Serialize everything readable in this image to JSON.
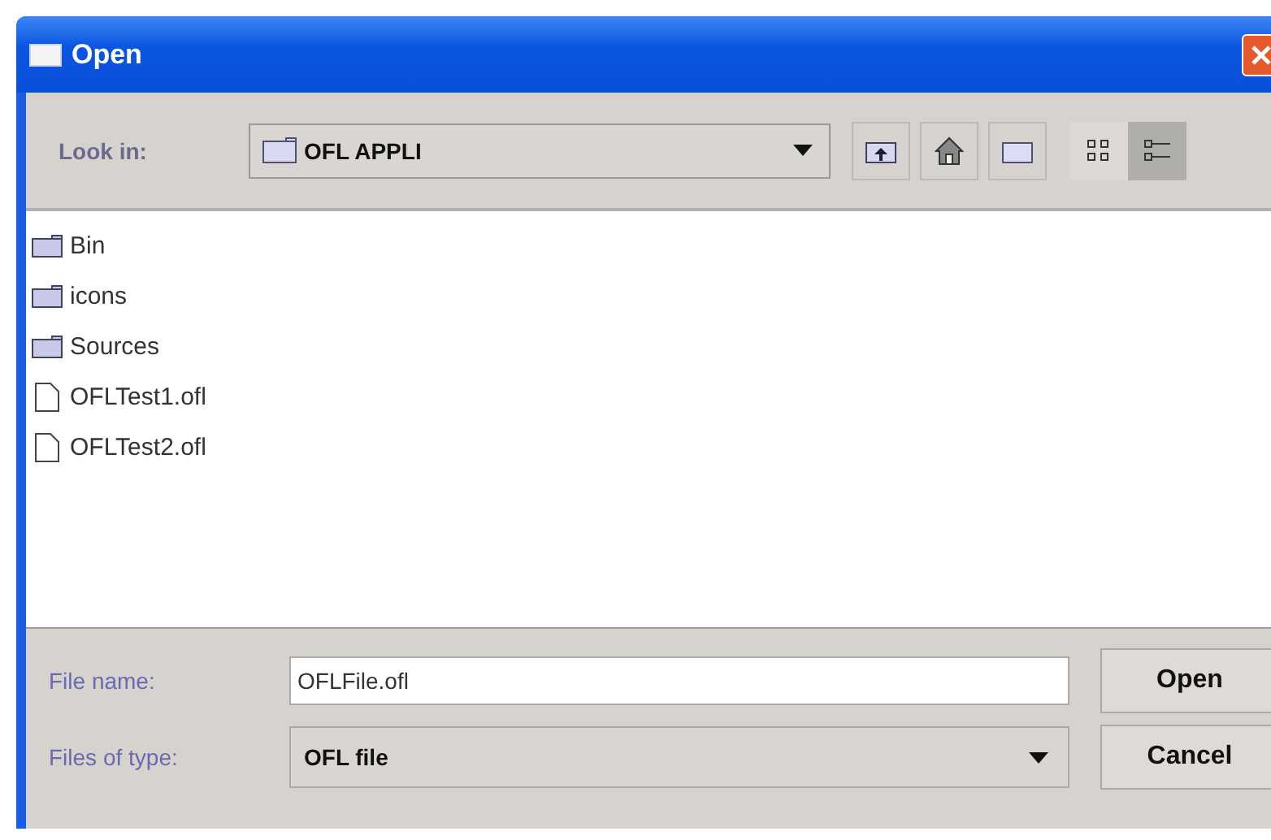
{
  "window": {
    "title": "Open"
  },
  "look_in": {
    "label": "Look in:",
    "value": "OFL APPLI"
  },
  "toolbar": [
    {
      "kind": "up-folder"
    },
    {
      "kind": "home"
    },
    {
      "kind": "new-folder"
    }
  ],
  "views": [
    {
      "kind": "list",
      "selected": false
    },
    {
      "kind": "details",
      "selected": true
    }
  ],
  "files": [
    {
      "name": "Bin",
      "kind": "folder"
    },
    {
      "name": "icons",
      "kind": "folder"
    },
    {
      "name": "Sources",
      "kind": "folder"
    },
    {
      "name": "OFLTest1.ofl",
      "kind": "file"
    },
    {
      "name": "OFLTest2.ofl",
      "kind": "file"
    }
  ],
  "file_name": {
    "label": "File name:",
    "value": "OFLFile.ofl"
  },
  "file_type": {
    "label": "Files of type:",
    "value": "OFL file"
  },
  "buttons": [
    "Open",
    "Cancel"
  ]
}
